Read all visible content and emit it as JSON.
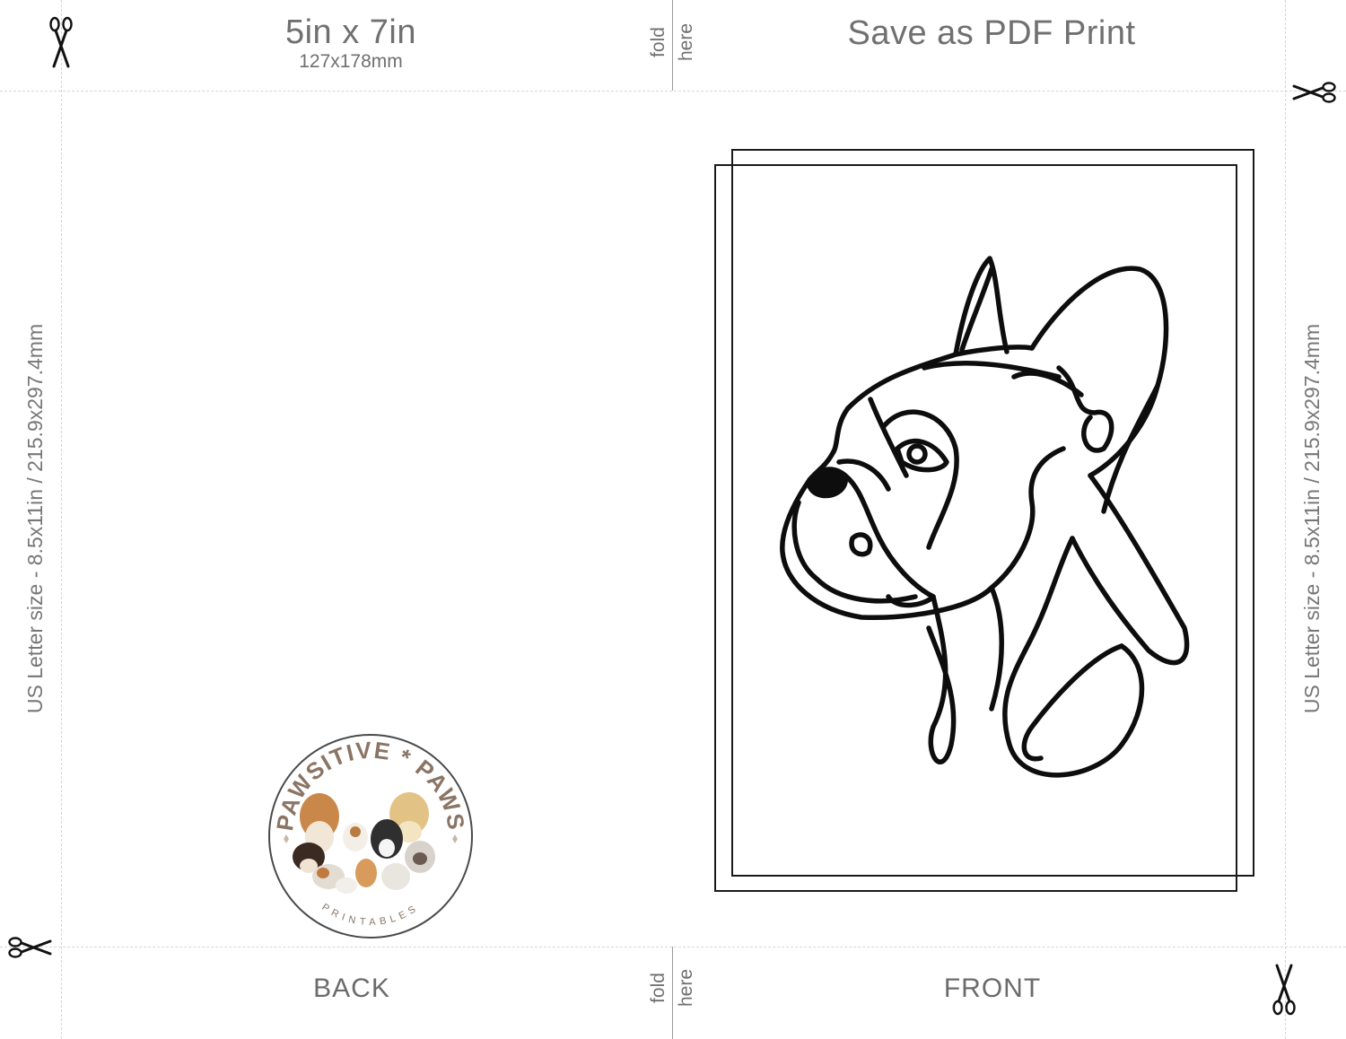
{
  "header": {
    "size_main": "5in x 7in",
    "size_sub": "127x178mm",
    "fold_top": "fold",
    "here_top": "here",
    "pdf_title": "Save as PDF Print"
  },
  "side": {
    "left_label": "US Letter size - 8.5x11in / 215.9x297.4mm",
    "right_label": "US Letter size - 8.5x11in / 215.9x297.4mm"
  },
  "footer": {
    "back_label": "BACK",
    "front_label": "FRONT",
    "fold_bottom": "fold",
    "here_bottom": "here"
  },
  "logo": {
    "top_text": "PAWSITIVE * PAWS",
    "bottom_text": "PRINTABLES"
  },
  "colors": {
    "guide": "#d6d6d6",
    "label_text": "#707070",
    "frame": "#1a1a1a",
    "logo_brown": "#8a7565"
  },
  "icons": [
    "scissors-icon",
    "french-bulldog-line-art"
  ]
}
